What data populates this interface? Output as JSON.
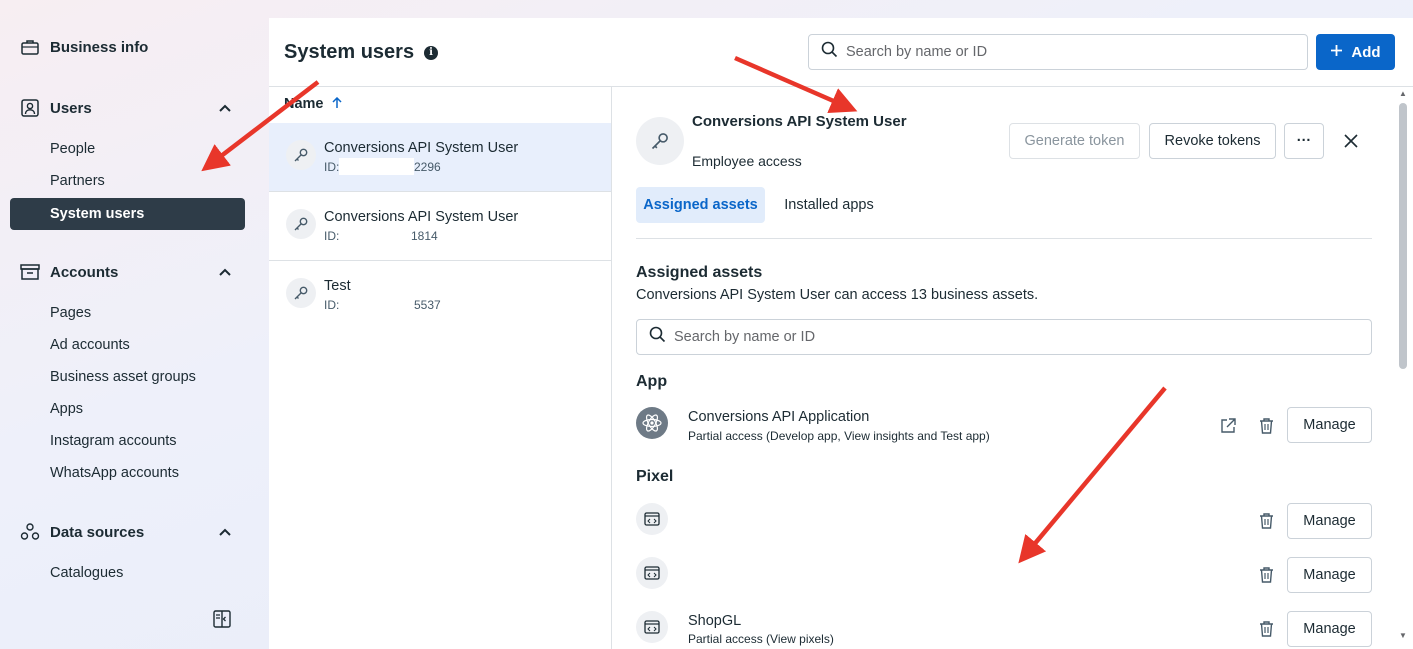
{
  "sidebar": {
    "business_info": "Business info",
    "users": {
      "label": "Users",
      "items": [
        "People",
        "Partners",
        "System users"
      ]
    },
    "accounts": {
      "label": "Accounts",
      "items": [
        "Pages",
        "Ad accounts",
        "Business asset groups",
        "Apps",
        "Instagram accounts",
        "WhatsApp accounts"
      ]
    },
    "data_sources": {
      "label": "Data sources",
      "items": [
        "Catalogues"
      ]
    }
  },
  "header": {
    "title": "System users",
    "search_placeholder": "Search by name or ID",
    "add_label": "Add"
  },
  "list": {
    "column_header": "Name",
    "rows": [
      {
        "name": "Conversions API System User",
        "id_label": "ID:",
        "id_value": "2296"
      },
      {
        "name": "Conversions API System User",
        "id_label": "ID:",
        "id_value": "1814"
      },
      {
        "name": "Test",
        "id_label": "ID:",
        "id_value": "5537"
      }
    ]
  },
  "detail": {
    "name": "Conversions API System User",
    "role": "Employee access",
    "generate_token": "Generate token",
    "revoke_tokens": "Revoke tokens",
    "more": "···",
    "tabs": [
      "Assigned assets",
      "Installed apps"
    ],
    "assets_title": "Assigned assets",
    "assets_subtitle": "Conversions API System User can access 13 business assets.",
    "search_placeholder": "Search by name or ID",
    "app_section": "App",
    "app": {
      "name": "Conversions API Application",
      "access": "Partial access (Develop app, View insights and Test app)"
    },
    "pixel_section": "Pixel",
    "pixels": [
      {
        "name": "",
        "access": ""
      },
      {
        "name": "",
        "access": ""
      },
      {
        "name": "ShopGL",
        "access": "Partial access (View pixels)"
      }
    ],
    "manage_label": "Manage"
  },
  "colors": {
    "accent": "#0a66c9",
    "sidebar_active": "#2e3c48",
    "annotation": "#e8362a"
  }
}
